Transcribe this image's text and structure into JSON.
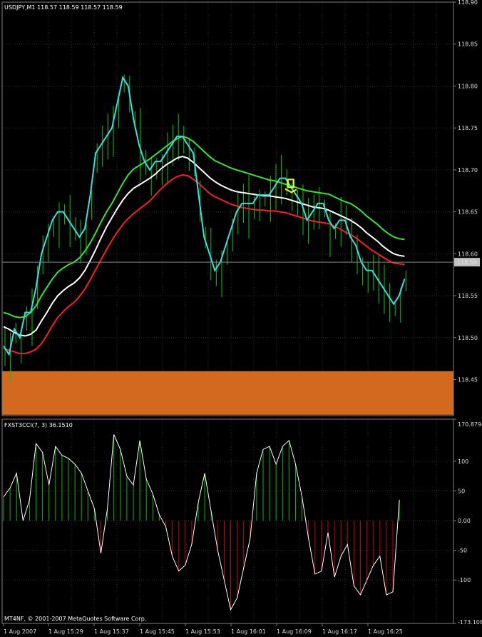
{
  "main_header": "USDJPY,M1  118.57 118.59 118.57 118.59",
  "indicator_header": "FXST3CCI(7, 3) 36.1510",
  "copyright": "MT4NF, © 2001-2007 MetaQuotes Software Corp.",
  "current_price_label": "118.59",
  "colors": {
    "background": "#000000",
    "grid": "#2d2d2d",
    "frame": "#808080",
    "candle": "#00cc00",
    "price_line": "#33e0e8",
    "ma_green": "#2ee82e",
    "ma_white": "#ffffff",
    "ma_red": "#ff1e1e",
    "zone": "#d2691e",
    "signal_box": "#ffff00",
    "hist_positive": "#00bb00",
    "hist_negative": "#cc0000",
    "cci_line": "#ffffff"
  },
  "chart_data": [
    {
      "type": "line",
      "title": "USDJPY,M1  118.57 118.59 118.57 118.59",
      "y_ticks": [
        "118.90",
        "118.85",
        "118.80",
        "118.75",
        "118.70",
        "118.65",
        "118.60",
        "118.55",
        "118.50",
        "118.45"
      ],
      "ylim": [
        118.407,
        118.9
      ],
      "x_labels": [
        "1 Aug 2007",
        "1 Aug 15:29",
        "1 Aug 15:37",
        "1 Aug 15:45",
        "1 Aug 15:53",
        "1 Aug 16:01",
        "1 Aug 16:09",
        "1 Aug 16:17",
        "1 Aug 16:25"
      ],
      "current_price": 118.59,
      "zone": [
        118.408,
        118.46
      ],
      "series": [
        {
          "key": "price",
          "values": [
            118.49,
            118.48,
            118.51,
            118.5,
            118.53,
            118.53,
            118.56,
            118.6,
            118.62,
            118.64,
            118.65,
            118.65,
            118.64,
            118.63,
            118.62,
            118.63,
            118.67,
            118.72,
            118.73,
            118.74,
            118.75,
            118.78,
            118.81,
            118.8,
            118.76,
            118.73,
            118.71,
            118.7,
            118.71,
            118.71,
            118.72,
            118.73,
            118.74,
            118.74,
            118.73,
            118.72,
            118.67,
            118.62,
            118.6,
            118.58,
            118.59,
            118.61,
            118.63,
            118.65,
            118.66,
            118.66,
            118.66,
            118.67,
            118.67,
            118.67,
            118.68,
            118.69,
            118.69,
            118.68,
            118.67,
            118.66,
            118.64,
            118.65,
            118.66,
            118.66,
            118.64,
            118.63,
            118.64,
            118.64,
            118.62,
            118.61,
            118.59,
            118.58,
            118.58,
            118.57,
            118.56,
            118.55,
            118.54,
            118.55,
            118.57
          ]
        },
        {
          "key": "ma_green",
          "values": [
            118.53,
            118.528,
            118.525,
            118.524,
            118.525,
            118.53,
            118.538,
            118.55,
            118.56,
            118.57,
            118.578,
            118.583,
            118.587,
            118.59,
            118.595,
            118.603,
            118.613,
            118.625,
            118.638,
            118.65,
            118.66,
            118.672,
            118.684,
            118.694,
            118.701,
            118.705,
            118.709,
            118.713,
            118.718,
            118.723,
            118.728,
            118.733,
            118.737,
            118.74,
            118.738,
            118.734,
            118.728,
            118.722,
            118.716,
            118.711,
            118.708,
            118.705,
            118.702,
            118.7,
            118.698,
            118.696,
            118.694,
            118.692,
            118.69,
            118.688,
            118.687,
            118.685,
            118.683,
            118.681,
            118.679,
            118.677,
            118.675,
            118.674,
            118.673,
            118.672,
            118.671,
            118.668,
            118.665,
            118.662,
            118.66,
            118.656,
            118.651,
            118.645,
            118.64,
            118.635,
            118.629,
            118.624,
            118.62,
            118.618,
            118.617
          ]
        },
        {
          "key": "ma_white",
          "values": [
            118.513,
            118.51,
            118.506,
            118.503,
            118.502,
            118.504,
            118.509,
            118.52,
            118.53,
            118.541,
            118.55,
            118.556,
            118.561,
            118.565,
            118.571,
            118.58,
            118.592,
            118.605,
            118.619,
            118.632,
            118.643,
            118.654,
            118.664,
            118.672,
            118.678,
            118.682,
            118.686,
            118.69,
            118.695,
            118.701,
            118.706,
            118.71,
            118.714,
            118.716,
            118.714,
            118.709,
            118.703,
            118.697,
            118.691,
            118.686,
            118.682,
            118.679,
            118.676,
            118.674,
            118.673,
            118.672,
            118.671,
            118.67,
            118.669,
            118.669,
            118.668,
            118.667,
            118.666,
            118.664,
            118.662,
            118.66,
            118.658,
            118.656,
            118.655,
            118.654,
            118.652,
            118.649,
            118.646,
            118.643,
            118.64,
            118.636,
            118.631,
            118.625,
            118.62,
            118.615,
            118.609,
            118.604,
            118.6,
            118.598,
            118.597
          ]
        },
        {
          "key": "ma_red",
          "values": [
            118.487,
            118.485,
            118.483,
            118.481,
            118.481,
            118.483,
            118.486,
            118.493,
            118.503,
            118.514,
            118.524,
            118.531,
            118.537,
            118.542,
            118.549,
            118.558,
            118.569,
            118.581,
            118.593,
            118.605,
            118.616,
            118.626,
            118.635,
            118.642,
            118.648,
            118.653,
            118.658,
            118.663,
            118.67,
            118.677,
            118.683,
            118.688,
            118.692,
            118.694,
            118.693,
            118.689,
            118.684,
            118.678,
            118.672,
            118.668,
            118.665,
            118.662,
            118.659,
            118.657,
            118.655,
            118.654,
            118.653,
            118.652,
            118.652,
            118.651,
            118.651,
            118.65,
            118.649,
            118.647,
            118.645,
            118.643,
            118.641,
            118.639,
            118.638,
            118.637,
            118.636,
            118.633,
            118.63,
            118.626,
            118.623,
            118.619,
            118.614,
            118.609,
            118.604,
            118.6,
            118.596,
            118.592,
            118.589,
            118.588,
            118.587
          ]
        }
      ]
    },
    {
      "type": "bar",
      "title": "FXST3CCI(7, 3) 36.1510",
      "y_ticks": [
        "170.8794",
        "100",
        "50",
        "0.00",
        "-50",
        "-100",
        "-173.1087"
      ],
      "ylim": [
        -173.1087,
        170.8794
      ],
      "x_labels": [
        "1 Aug 2007",
        "1 Aug 15:29",
        "1 Aug 15:37",
        "1 Aug 15:45",
        "1 Aug 15:53",
        "1 Aug 16:01",
        "1 Aug 16:09",
        "1 Aug 16:17",
        "1 Aug 16:25"
      ],
      "values": [
        40,
        55,
        80,
        0,
        35,
        130,
        115,
        60,
        125,
        110,
        105,
        95,
        80,
        50,
        20,
        -55,
        20,
        145,
        120,
        75,
        60,
        135,
        70,
        45,
        10,
        -10,
        -60,
        -85,
        -75,
        -40,
        30,
        80,
        15,
        -50,
        -100,
        -150,
        -130,
        -80,
        -30,
        80,
        120,
        125,
        95,
        125,
        135,
        95,
        40,
        -30,
        -90,
        -85,
        -20,
        -95,
        -60,
        -40,
        -110,
        -125,
        -100,
        -75,
        -60,
        -125,
        -120,
        35
      ]
    }
  ]
}
